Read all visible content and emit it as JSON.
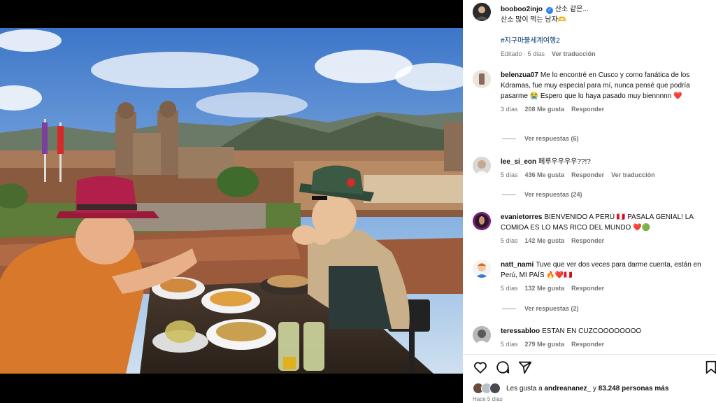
{
  "post": {
    "author": "booboo2injo",
    "caption_line1": "산소 같은...",
    "caption_line2": "산소 많이 먹는 남자🫶",
    "hashtag": "#지구마불세계여행2",
    "edited": "Editado · 5 días",
    "translate": "Ver traducción"
  },
  "comments": [
    {
      "user": "belenzua07",
      "text": "Me lo encontré en Cusco y como fanática de los Kdramas, fue muy especial para mí, nunca pensé que podría pasarme 😭 Espero que lo haya pasado muy biennnnn",
      "heart": "❤️",
      "time": "3 días",
      "likes": "208 Me gusta",
      "reply": "Responder",
      "translate": "",
      "replies": "Ver respuestas (6)"
    },
    {
      "user": "lee_si_eon",
      "text": "페루우우우우??!?",
      "heart": "",
      "time": "5 días",
      "likes": "436 Me gusta",
      "reply": "Responder",
      "translate": "Ver traducción",
      "replies": "Ver respuestas (24)"
    },
    {
      "user": "evanietorres",
      "text": "BIENVENIDO A PERÚ 🇵🇪 PASALA GENIAL! LA COMIDA ES LO MAS RICO DEL MUNDO ❤️🟢",
      "heart": "",
      "time": "5 días",
      "likes": "142 Me gusta",
      "reply": "Responder",
      "translate": "",
      "replies": ""
    },
    {
      "user": "natt_nami",
      "text": "Tuve que ver dos veces para darme cuenta, están en Perú, MI PAÍS 🔥❤️🇵🇪",
      "heart": "",
      "time": "5 días",
      "likes": "132 Me gusta",
      "reply": "Responder",
      "translate": "",
      "replies": "Ver respuestas (2)"
    },
    {
      "user": "teressabloo",
      "text": "ESTAN EN CUZCOOOOOOOO",
      "heart": "",
      "time": "5 días",
      "likes": "279 Me gusta",
      "reply": "Responder",
      "translate": "",
      "replies": ""
    }
  ],
  "footer": {
    "likes_prefix": "Les gusta a",
    "likes_user": "andreananez_",
    "likes_and": "y",
    "likes_count": "83.248 personas más",
    "time": "Hace 5 días"
  },
  "icons": [
    "heart-icon",
    "comment-icon",
    "share-icon",
    "bookmark-icon",
    "verified-icon"
  ],
  "colors": {
    "accent": "#0095f6",
    "like": "#e0245e",
    "link": "#00376b"
  }
}
